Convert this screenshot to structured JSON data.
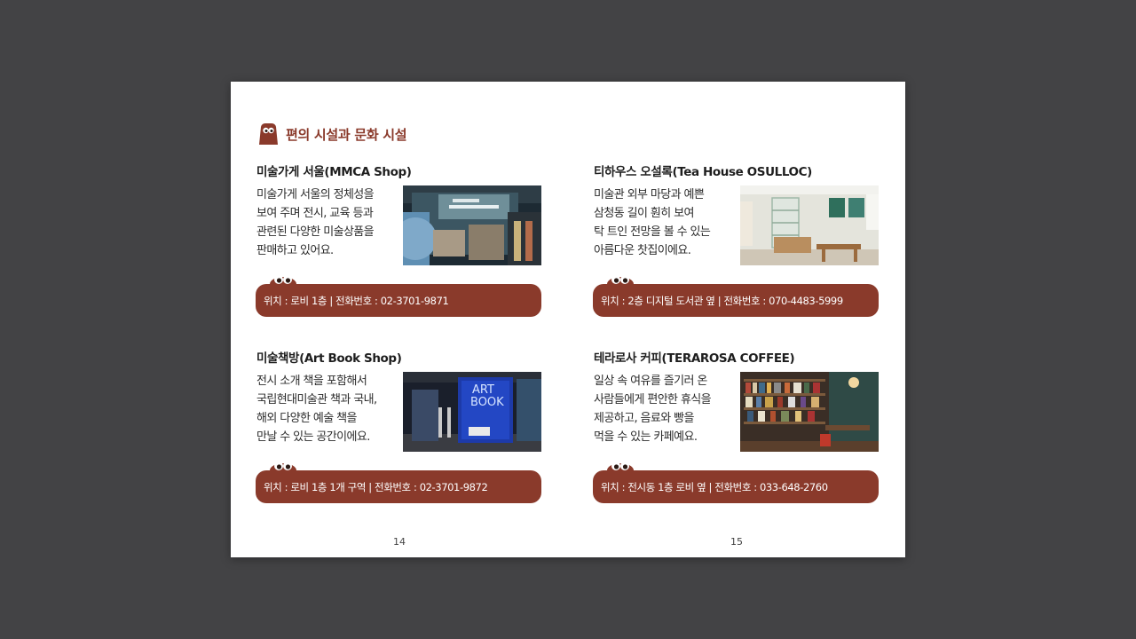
{
  "section_title": "편의 시설과 문화 시설",
  "cards": [
    {
      "title": "미술가게 서울(MMCA Shop)",
      "desc": [
        "미술가게 서울의 정체성을",
        "보여 주며 전시, 교육 등과",
        "관련된 다양한 미술상품을",
        "판매하고 있어요."
      ],
      "info": "위치 : 로비 1층 | 전화번호 : 02-3701-9871",
      "photo": "mmca-shop-photo"
    },
    {
      "title": "티하우스 오설록(Tea House OSULLOC)",
      "desc": [
        "미술관 외부 마당과 예쁜",
        "삼청동 길이 훤히 보여",
        "탁 트인 전망을 볼 수 있는",
        "아름다운 찻집이에요."
      ],
      "info": "위치 : 2층 디지털 도서관 옆 | 전화번호 : 070-4483-5999",
      "photo": "tea-house-photo"
    },
    {
      "title": "미술책방(Art Book Shop)",
      "desc": [
        "전시 소개 책을 포함해서",
        "국립현대미술관 책과 국내,",
        "해외 다양한 예술 책을",
        "만날 수 있는 공간이에요."
      ],
      "info": "위치 : 로비 1층 1개 구역 | 전화번호 : 02-3701-9872",
      "photo": "art-book-shop-photo",
      "photo_sign": [
        "ART",
        "BOOK"
      ]
    },
    {
      "title": "테라로사 커피(TERAROSA COFFEE)",
      "desc": [
        "일상 속 여유를 즐기러 온",
        "사람들에게 편안한 휴식을",
        "제공하고, 음료와 빵을",
        "먹을 수 있는 카페예요."
      ],
      "info": "위치 : 전시동 1층 로비 옆 | 전화번호 : 033-648-2760",
      "photo": "terarosa-photo"
    }
  ],
  "page_numbers": {
    "left": "14",
    "right": "15"
  },
  "colors": {
    "accent": "#8a3a2b",
    "background": "#434345",
    "page": "#ffffff"
  }
}
